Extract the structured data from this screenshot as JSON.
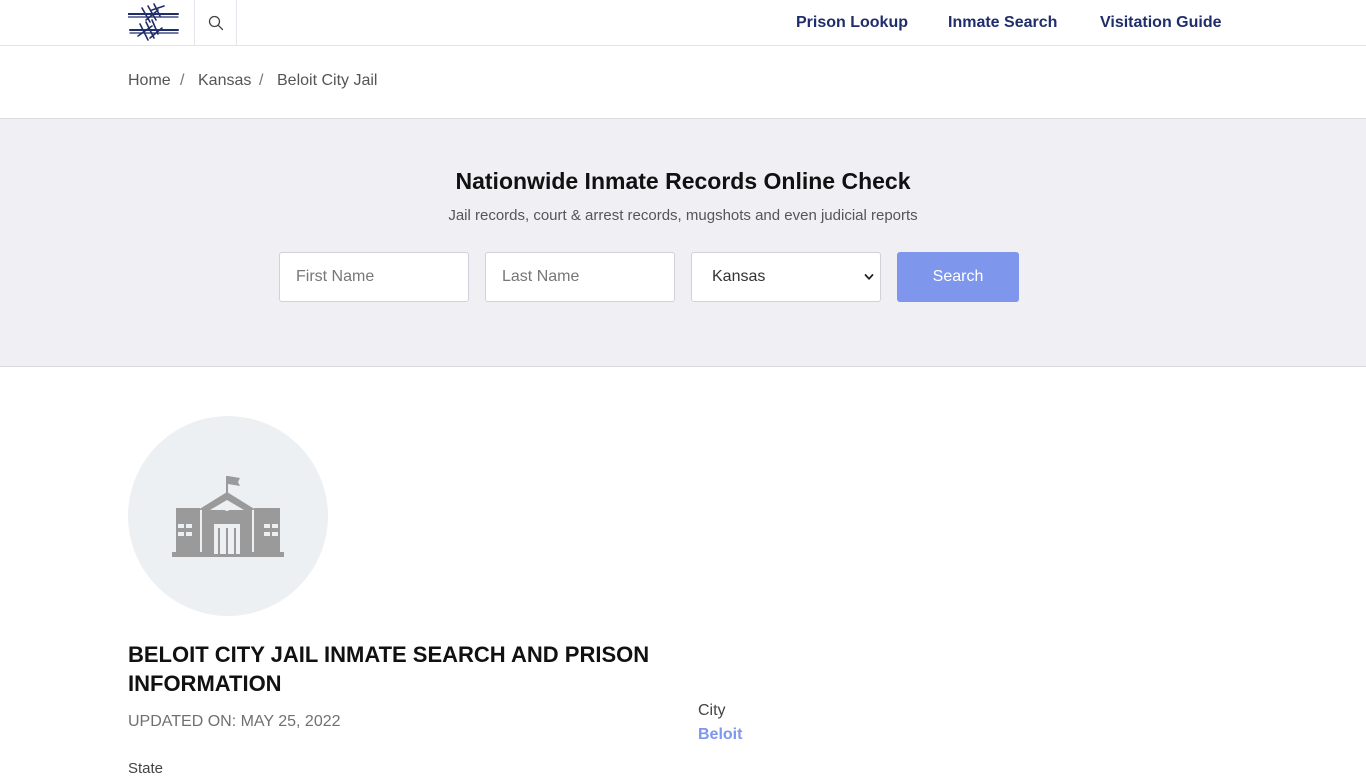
{
  "header": {
    "nav": [
      {
        "label": "Prison Lookup"
      },
      {
        "label": "Inmate Search"
      },
      {
        "label": "Visitation Guide"
      }
    ]
  },
  "breadcrumb": [
    {
      "label": "Home"
    },
    {
      "label": "Kansas"
    },
    {
      "label": "Beloit City Jail"
    }
  ],
  "breadcrumb_separator": "/",
  "search": {
    "title": "Nationwide Inmate Records Online Check",
    "subtitle": "Jail records, court & arrest records, mugshots and even judicial reports",
    "first_name_placeholder": "First Name",
    "last_name_placeholder": "Last Name",
    "state_selected": "Kansas",
    "button_label": "Search"
  },
  "facility": {
    "title": "BELOIT CITY JAIL INMATE SEARCH AND PRISON INFORMATION",
    "updated": "UPDATED ON: MAY 25, 2022",
    "state_label": "State",
    "city_label": "City",
    "city_value": "Beloit",
    "icon": "jail-building-icon"
  },
  "colors": {
    "nav_text": "#1f2d6b",
    "accent": "#7e97ec",
    "hero_bg": "#f0f0f4"
  }
}
